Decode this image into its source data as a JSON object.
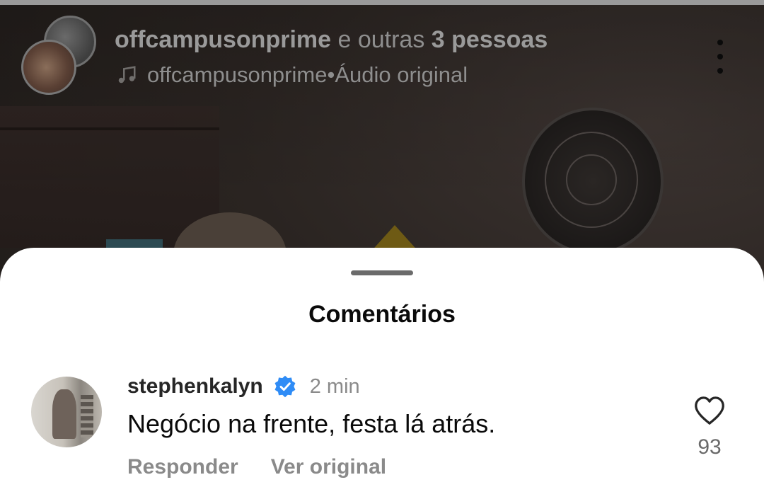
{
  "header": {
    "primary_user": "offcampusonprime",
    "connector": " e outras ",
    "others": "3 pessoas",
    "audio_owner": "offcampusonprime",
    "audio_separator": " • ",
    "audio_label": "Áudio original",
    "icons": {
      "music": "music-note-icon",
      "more": "more-vertical-icon"
    }
  },
  "sheet": {
    "title": "Comentários"
  },
  "comments": [
    {
      "username": "stephenkalyn",
      "verified": true,
      "time": "2 min",
      "text": "Negócio na frente, festa lá atrás.",
      "reply_label": "Responder",
      "see_original_label": "Ver original",
      "likes": "93"
    }
  ],
  "colors": {
    "verified_blue": "#2f8cf6",
    "sheet_bg": "#ffffff",
    "muted_text": "#8a8a8a",
    "primary_text": "#0a0a0a"
  }
}
